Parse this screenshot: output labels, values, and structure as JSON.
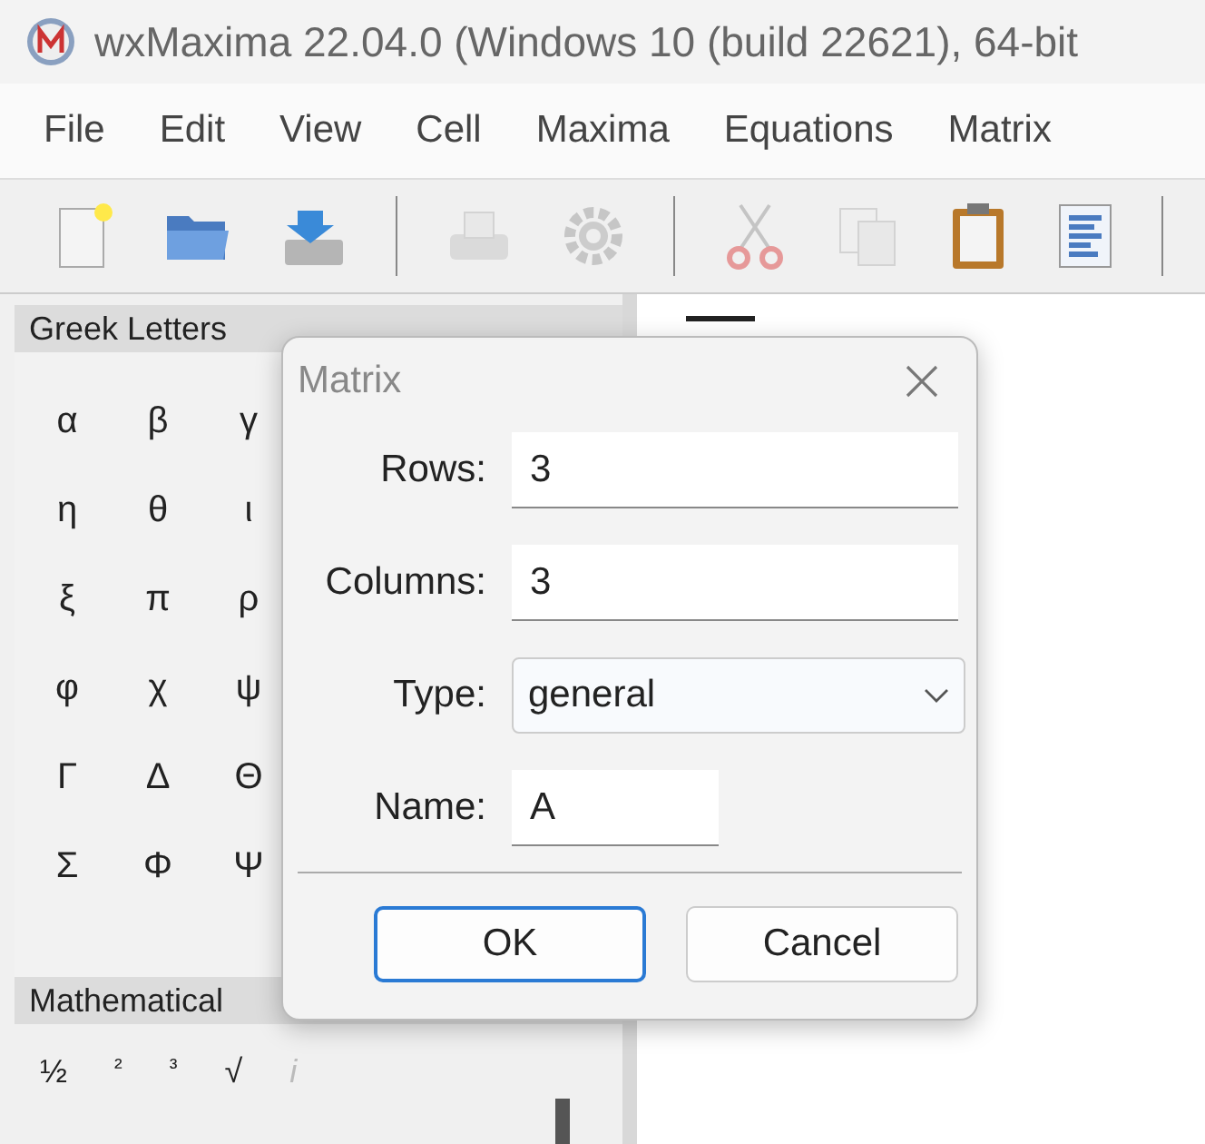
{
  "window": {
    "title": "wxMaxima 22.04.0 (Windows 10 (build 22621), 64-bit"
  },
  "menu": [
    "File",
    "Edit",
    "View",
    "Cell",
    "Maxima",
    "Equations",
    "Matrix"
  ],
  "toolbar": [
    {
      "kind": "new",
      "disabled": false
    },
    {
      "kind": "open",
      "disabled": false
    },
    {
      "kind": "save",
      "disabled": false
    },
    {
      "kind": "separator"
    },
    {
      "kind": "print",
      "disabled": true
    },
    {
      "kind": "settings",
      "disabled": true
    },
    {
      "kind": "separator"
    },
    {
      "kind": "cut",
      "disabled": true
    },
    {
      "kind": "copy",
      "disabled": true
    },
    {
      "kind": "paste",
      "disabled": false
    },
    {
      "kind": "text",
      "disabled": false
    },
    {
      "kind": "separator"
    }
  ],
  "greek_panel": {
    "title": "Greek Letters",
    "symbols": [
      "α",
      "β",
      "γ",
      "η",
      "θ",
      "ι",
      "ξ",
      "π",
      "ρ",
      "φ",
      "χ",
      "ψ",
      "Γ",
      "Δ",
      "Θ",
      "Σ",
      "Φ",
      "Ψ"
    ]
  },
  "math_panel": {
    "title": "Mathematical",
    "symbols": [
      {
        "label": "½",
        "disabled": false
      },
      {
        "label": "²",
        "disabled": false
      },
      {
        "label": "³",
        "disabled": false
      },
      {
        "label": "√",
        "disabled": false
      },
      {
        "label": "i",
        "disabled": true
      }
    ]
  },
  "dialog": {
    "title": "Matrix",
    "fields": [
      {
        "kind": "text",
        "label": "Rows:",
        "value": "3"
      },
      {
        "kind": "text",
        "label": "Columns:",
        "value": "3"
      },
      {
        "kind": "select",
        "label": "Type:",
        "value": "general"
      },
      {
        "kind": "short",
        "label": "Name:",
        "value": "A"
      }
    ],
    "buttons": [
      {
        "label": "OK",
        "default": true
      },
      {
        "label": "Cancel",
        "default": false
      }
    ]
  }
}
